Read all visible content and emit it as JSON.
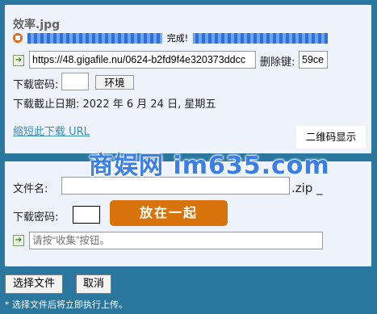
{
  "upload": {
    "file_name": "效率.jpg",
    "progress_percent": 100,
    "progress_label": "完成!",
    "url_value": "https://48.gigafile.nu/0624-b2fd9f4e320373ddcc",
    "delete_key_label": "删除键:",
    "delete_key_value": "59ce",
    "password_label": "下载密码:",
    "password_value": "",
    "env_button": "环境",
    "expiry_text": "下载截止日期: 2022 年 6 月 24 日, 星期五",
    "shorten_link": "缩短此下载 URL",
    "qr_button": "二维码显示"
  },
  "watermark": "商娱网 im635.com",
  "form": {
    "filename_label": "文件名:",
    "filename_value": "",
    "zip_suffix": ".zip _",
    "password_label": "下载密码:",
    "password_value": "",
    "put_button": "放在一起",
    "collect_placeholder": "请按“收集”按钮。"
  },
  "footer": {
    "choose_file_button": "选择文件",
    "cancel_button": "取消",
    "note": "* 选择文件后将立即执行上传。"
  },
  "colors": {
    "background": "#2a77a0",
    "panel": "#eef2fb",
    "accent_orange": "#d8730c",
    "progress_blue": "#2f6fd6",
    "link": "#3a8fbf"
  },
  "icons": {
    "stop": "stop-icon",
    "arrow": "arrow-right-icon"
  }
}
